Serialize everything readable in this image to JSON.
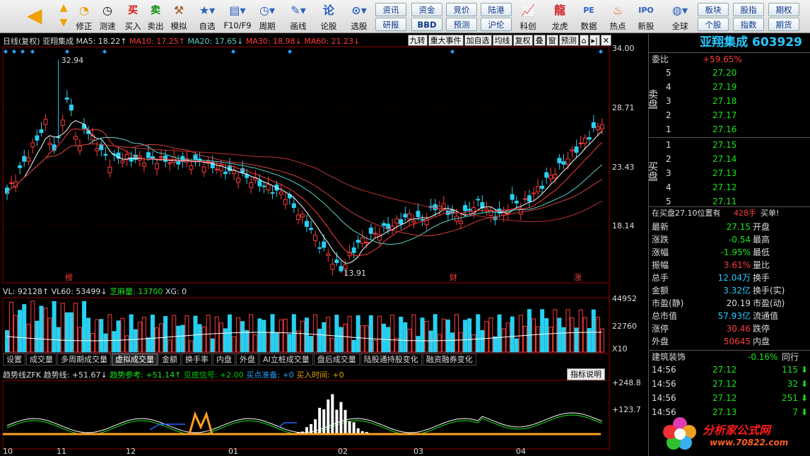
{
  "toolbar": {
    "items": [
      {
        "label": "修正",
        "icon": "refresh-icon"
      },
      {
        "label": "测速",
        "icon": "speed-icon"
      },
      {
        "label": "买入",
        "icon": "buy-icon"
      },
      {
        "label": "卖出",
        "icon": "sell-icon"
      },
      {
        "label": "模拟",
        "icon": "hammer-icon"
      },
      {
        "label": "自选",
        "icon": "star-icon"
      },
      {
        "label": "F10/F9",
        "icon": "f10-icon"
      },
      {
        "label": "周期",
        "icon": "clock-icon"
      },
      {
        "label": "画线",
        "icon": "pen-icon"
      },
      {
        "label": "论股",
        "icon": "chat-icon"
      },
      {
        "label": "选股",
        "icon": "search-icon"
      },
      {
        "label": "科创",
        "icon": "chart-icon"
      },
      {
        "label": "龙虎",
        "icon": "dragon-icon"
      },
      {
        "label": "数据",
        "icon": "pe-icon"
      },
      {
        "label": "热点",
        "icon": "fire-icon"
      },
      {
        "label": "新股",
        "icon": "ipo-icon"
      },
      {
        "label": "全球",
        "icon": "globe-icon"
      }
    ],
    "buy_glyph": "买",
    "sell_glyph": "卖",
    "small_buttons": [
      "资讯",
      "资金",
      "竞价",
      "陆港",
      "研报",
      "BBD",
      "预测",
      "沪伦",
      "板块",
      "股指",
      "期权",
      "个股",
      "指数",
      "期货"
    ]
  },
  "kline": {
    "period": "日线(复权)",
    "name": "亚翔集成",
    "ma5": "MA5: 18.22↑",
    "ma10": "MA10: 17.25↑",
    "ma20": "MA20: 17.65↓",
    "ma30": "MA30: 18.98↓",
    "ma60": "MA60: 21.23↓",
    "buttons": [
      "九转",
      "重大事件",
      "加自选",
      "均线",
      "复权",
      "叠",
      "窗",
      "预测"
    ],
    "y_labels": [
      "34.00",
      "28.71",
      "23.43",
      "18.14"
    ],
    "high_label": "32.94",
    "low_label": "13.91",
    "markers": [
      "榜",
      "财",
      "涨"
    ]
  },
  "volume": {
    "vl": "VL: 92128↑",
    "vl60": "VL60: 53499↓",
    "zmm": "芝麻量: 13700",
    "xg": "XG: 0",
    "y_labels": [
      "44952",
      "22760",
      "X10"
    ]
  },
  "tabs": [
    "设置",
    "成交量",
    "多周期成交量",
    "虚拟成交量",
    "金额",
    "换手率",
    "内盘",
    "外盘",
    "AI立桩成交量",
    "盘后成交量",
    "陆股通持股变化",
    "融资融券变化"
  ],
  "active_tab": "虚拟成交量",
  "indicator": {
    "title": "趋势线ZFK",
    "trend": "趋势线: +51.67↓",
    "ref": "趋势参考: +51.14↑",
    "signal": "见底信号: +2.00",
    "ready": "买点准备: +0",
    "time": "买入时间: +0",
    "help": "指标说明",
    "y_labels": [
      "+248.8",
      "+123.7"
    ]
  },
  "x_labels": [
    "10",
    "11",
    "12",
    "01",
    "02",
    "03",
    "04"
  ],
  "quote": {
    "title": "亚翔集成 603929",
    "weibi_label": "委比",
    "weibi_value": "+59.65%",
    "sell_label": "卖盘",
    "buy_label": "买盘",
    "asks": [
      {
        "n": "5",
        "p": "27.20"
      },
      {
        "n": "4",
        "p": "27.19"
      },
      {
        "n": "3",
        "p": "27.18"
      },
      {
        "n": "2",
        "p": "27.17"
      },
      {
        "n": "1",
        "p": "27.16"
      }
    ],
    "bids": [
      {
        "n": "1",
        "p": "27.15"
      },
      {
        "n": "2",
        "p": "27.14"
      },
      {
        "n": "3",
        "p": "27.13"
      },
      {
        "n": "4",
        "p": "27.12"
      },
      {
        "n": "5",
        "p": "27.11"
      }
    ],
    "notice": "在买盘27.10位置有",
    "notice_qty": "428手",
    "notice_action": "买单!",
    "stats": [
      {
        "l": "最新",
        "v": "27.15",
        "r": "开盘"
      },
      {
        "l": "涨跌",
        "v": "-0.54",
        "r": "最高"
      },
      {
        "l": "涨幅",
        "v": "-1.95%",
        "r": "最低"
      },
      {
        "l": "振幅",
        "v": "3.61%",
        "r": "量比"
      },
      {
        "l": "总手",
        "v": "12.04万",
        "r": "换手"
      },
      {
        "l": "金额",
        "v": "3.32亿",
        "r": "换手(实)"
      },
      {
        "l": "市盈(静)",
        "v": "20.19",
        "r": "市盈(动)"
      },
      {
        "l": "总市值",
        "v": "57.93亿",
        "r": "流通值"
      },
      {
        "l": "涨停",
        "v": "30.46",
        "r": "跌停"
      },
      {
        "l": "外盘",
        "v": "50645",
        "r": "内盘"
      }
    ],
    "sector": "建筑装饰",
    "sector_change": "-0.16%",
    "sector_tab": "同行",
    "ticks": [
      {
        "t": "14:56",
        "p": "27.12",
        "v": "115"
      },
      {
        "t": "14:56",
        "p": "27.12",
        "v": "32"
      },
      {
        "t": "14:56",
        "p": "27.12",
        "v": "251"
      },
      {
        "t": "14:56",
        "p": "27.13",
        "v": "7"
      }
    ]
  },
  "watermark": {
    "title": "分析家公式网",
    "url": "www.70822.com"
  }
}
